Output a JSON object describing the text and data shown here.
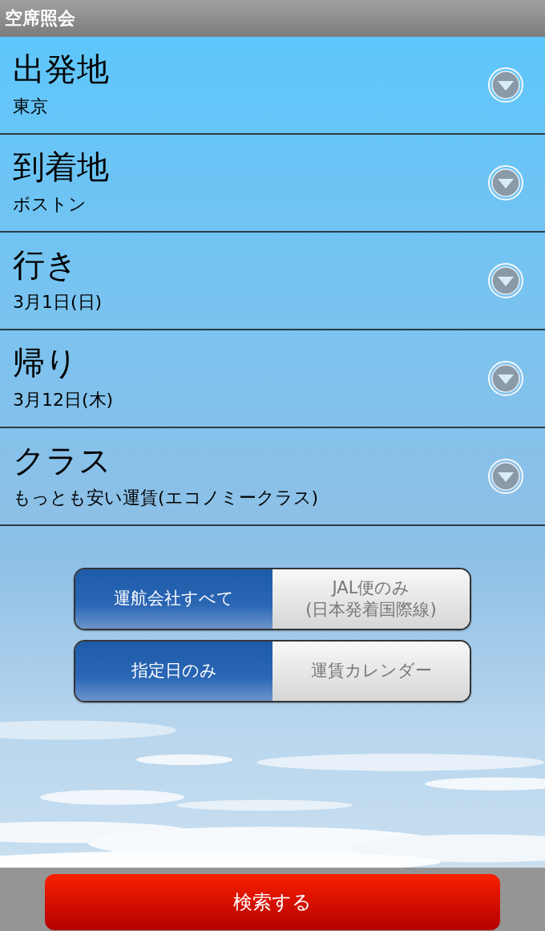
{
  "window": {
    "title": "空席照会"
  },
  "fields": [
    {
      "label": "出発地",
      "value": "東京"
    },
    {
      "label": "到着地",
      "value": "ボストン"
    },
    {
      "label": "行き",
      "value": "3月1日(日)"
    },
    {
      "label": "帰り",
      "value": "3月12日(木)"
    },
    {
      "label": "クラス",
      "value": "もっとも安い運賃(エコノミークラス)"
    }
  ],
  "toggles": [
    {
      "options": [
        {
          "lines": [
            "運航会社すべて"
          ],
          "selected": true
        },
        {
          "lines": [
            "JAL便のみ",
            "(日本発着国際線)"
          ],
          "selected": false
        }
      ]
    },
    {
      "options": [
        {
          "lines": [
            "指定日のみ"
          ],
          "selected": true
        },
        {
          "lines": [
            "運賃カレンダー"
          ],
          "selected": false
        }
      ]
    }
  ],
  "search_button": "検索する"
}
